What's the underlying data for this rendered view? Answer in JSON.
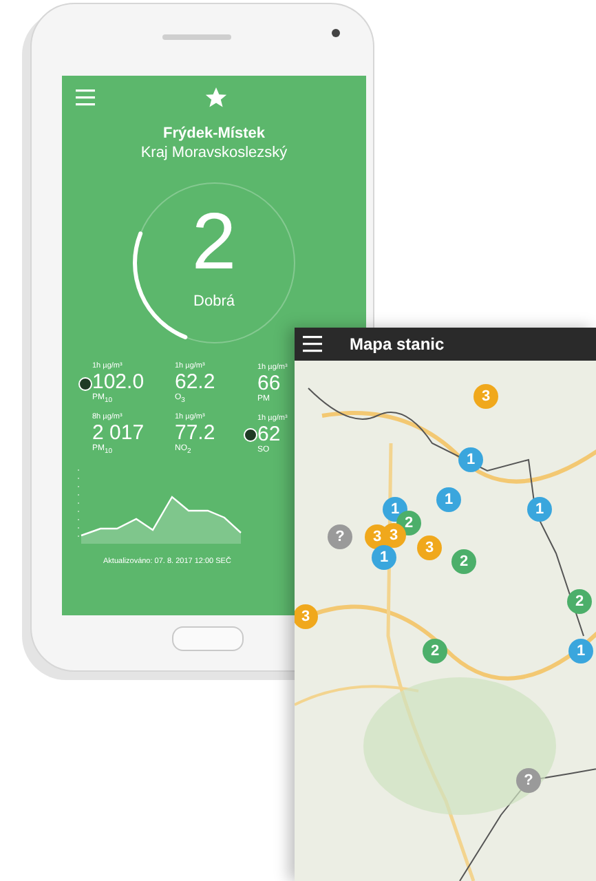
{
  "air_quality_screen": {
    "city": "Frýdek-Místek",
    "region": "Kraj Moravskoslezský",
    "index_value": "2",
    "index_label": "Dobrá",
    "gauge": {
      "level": 0.25
    },
    "measurements": [
      {
        "unit": "1h µg/m³",
        "value": "102.0",
        "pollutant": "PM$_{10}$",
        "flagged": true
      },
      {
        "unit": "1h µg/m³",
        "value": "62.2",
        "pollutant": "O$_{3}$",
        "flagged": false
      },
      {
        "unit": "1h µg/m³",
        "value": "66",
        "pollutant": "PM",
        "flagged": false
      },
      {
        "unit": "8h µg/m³",
        "value": "2 017",
        "pollutant": "PM$_{10}$",
        "flagged": false
      },
      {
        "unit": "1h µg/m³",
        "value": "77.2",
        "pollutant": "NO$_{2}$",
        "flagged": false
      },
      {
        "unit": "1h µg/m³",
        "value": "62",
        "pollutant": "SO",
        "flagged": true
      }
    ],
    "updated": "Aktualizováno: 07. 8. 2017 12:00 SEČ"
  },
  "map_screen": {
    "title": "Mapa stanic",
    "markers": [
      {
        "count": "3",
        "color": "#f0a81c"
      },
      {
        "count": "1",
        "color": "#3aa6dd"
      },
      {
        "count": "1",
        "color": "#3aa6dd"
      },
      {
        "count": "1",
        "color": "#3aa6dd"
      },
      {
        "count": "1",
        "color": "#3aa6dd"
      },
      {
        "count": "?",
        "color": "#9a9a9a"
      },
      {
        "count": "2",
        "color": "#4caf6a"
      },
      {
        "count": "3",
        "color": "#f0a81c"
      },
      {
        "count": "3",
        "color": "#f0a81c"
      },
      {
        "count": "3",
        "color": "#f0a81c"
      },
      {
        "count": "1",
        "color": "#3aa6dd"
      },
      {
        "count": "2",
        "color": "#4caf6a"
      },
      {
        "count": "3",
        "color": "#f0a81c"
      },
      {
        "count": "2",
        "color": "#4caf6a"
      },
      {
        "count": "2",
        "color": "#4caf6a"
      },
      {
        "count": "1",
        "color": "#3aa6dd"
      },
      {
        "count": "?",
        "color": "#9a9a9a"
      }
    ]
  }
}
